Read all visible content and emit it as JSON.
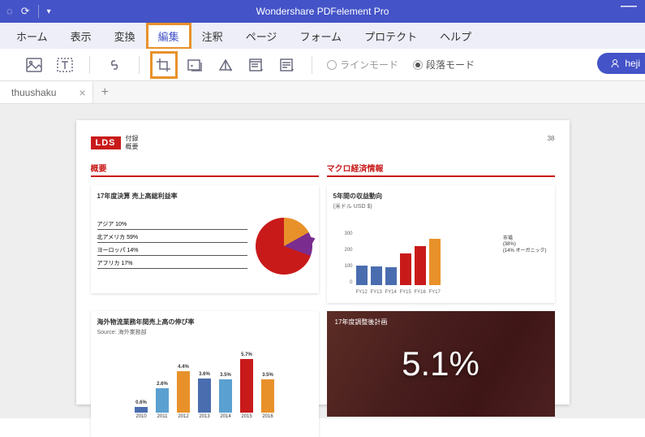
{
  "app": {
    "title": "Wondershare PDFelement Pro"
  },
  "menu": {
    "items": [
      "ホーム",
      "表示",
      "変換",
      "編集",
      "注釈",
      "ページ",
      "フォーム",
      "プロテクト",
      "ヘルプ"
    ],
    "selected": 3
  },
  "toolbar": {
    "radios": {
      "line": "ラインモード",
      "paragraph": "段落モード",
      "selected": "paragraph"
    },
    "user": "heji"
  },
  "tabs": {
    "open": [
      {
        "name": "thuushaku"
      }
    ]
  },
  "doc": {
    "brand": "LDS",
    "header_lines": [
      "付録",
      "概要"
    ],
    "page_num": "38",
    "sections": {
      "overview": "概要",
      "macro": "マクロ経済情報",
      "c1_title": "17年度決算 売上高総利益率",
      "c2_title": "5年間の収益動向",
      "c2_sub": "(米ドル USD $)",
      "c3_title": "海外物流業務年間売上高の伸び率",
      "c3_source": "Source: 海外業務部",
      "c4_title": "17年度調整後計画",
      "c4_value": "5.1%"
    }
  },
  "chart_data": [
    {
      "type": "pie",
      "title": "17年度決算 売上高総利益率",
      "categories": [
        "アジア",
        "北アメリカ",
        "ヨーロッパ",
        "アフリカ"
      ],
      "values": [
        10,
        59,
        14,
        17
      ],
      "labels": [
        "アジア 10%",
        "北アメリカ 59%",
        "ヨーロッパ 14%",
        "アフリカ 17%"
      ]
    },
    {
      "type": "bar",
      "title": "5年間の収益動向 (米ドル USD $)",
      "categories": [
        "FY12",
        "FY13",
        "FY14",
        "FY15",
        "FY16",
        "FY17"
      ],
      "values": [
        110,
        105,
        100,
        180,
        220,
        260
      ],
      "ylabel": "",
      "ylim": [
        0,
        300
      ],
      "yticks": [
        300,
        200,
        100,
        0
      ],
      "colors": [
        "#4a6db0",
        "#4a6db0",
        "#4a6db0",
        "#c91a1a",
        "#c91a1a",
        "#e8912a"
      ],
      "callout": {
        "lines": [
          "市場",
          "(38%)",
          "(14% オーガニック)"
        ]
      }
    },
    {
      "type": "bar",
      "title": "海外物流業務年間売上高の伸び率",
      "categories": [
        "2010",
        "2011",
        "2012",
        "2013",
        "2014",
        "2015",
        "2016"
      ],
      "values": [
        0.6,
        2.6,
        4.4,
        3.6,
        3.5,
        5.7,
        3.5
      ],
      "value_labels": [
        "0.6%",
        "2.6%",
        "4.4%",
        "3.6%",
        "3.5%",
        "5.7%",
        "3.5%"
      ],
      "colors": [
        "#4a6db0",
        "#5aa0d0",
        "#e8912a",
        "#4a6db0",
        "#5aa0d0",
        "#c91a1a",
        "#e8912a"
      ],
      "ylim": [
        0,
        6
      ]
    },
    {
      "type": "scalar",
      "title": "17年度調整後計画",
      "value": 5.1,
      "unit": "%"
    }
  ]
}
